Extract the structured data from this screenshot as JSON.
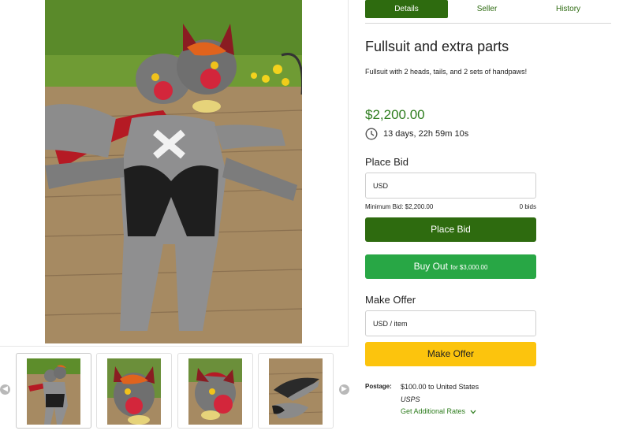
{
  "gallery": {
    "thumbnails": [
      {
        "alt": "fullsuit-laid-out"
      },
      {
        "alt": "orange-hair-head"
      },
      {
        "alt": "red-head"
      },
      {
        "alt": "tails"
      }
    ]
  },
  "tabs": [
    {
      "label": "Details"
    },
    {
      "label": "Seller"
    },
    {
      "label": "History"
    }
  ],
  "listing": {
    "title": "Fullsuit and extra parts",
    "description": "Fullsuit with 2 heads, tails, and 2 sets of handpaws!",
    "price": "$2,200.00",
    "time_left": "13 days, 22h 59m 10s"
  },
  "bid": {
    "label": "Place Bid",
    "placeholder": "USD",
    "minimum": "Minimum Bid: $2,200.00",
    "bids": "0 bids",
    "button": "Place Bid"
  },
  "buyout": {
    "label": "Buy Out",
    "for_price": "for $3,000.00"
  },
  "offer": {
    "label": "Make Offer",
    "placeholder": "USD / item",
    "button": "Make Offer"
  },
  "postage": {
    "label": "Postage:",
    "value": "$100.00 to United States",
    "carrier": "USPS",
    "rates_link": "Get Additional Rates"
  },
  "colors": {
    "dark_green": "#2e6b0f",
    "buy_green": "#28a745",
    "offer_yellow": "#fcc40d",
    "price_green": "#2e7d1e"
  }
}
